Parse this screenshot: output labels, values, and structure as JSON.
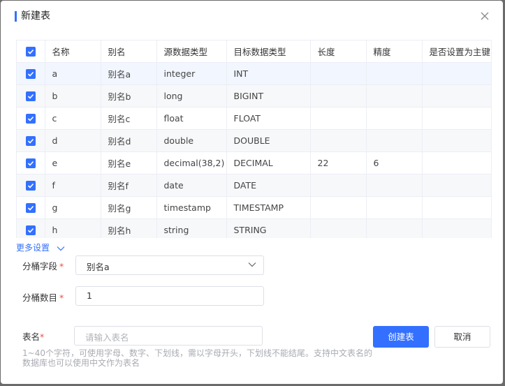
{
  "dialog": {
    "title": "新建表"
  },
  "table": {
    "columns": [
      "名称",
      "别名",
      "源数据类型",
      "目标数据类型",
      "长度",
      "精度",
      "是否设置为主键"
    ],
    "rows": [
      {
        "name": "a",
        "alias": "别名a",
        "src_type": "integer",
        "target_type": "INT",
        "length": "",
        "precision": ""
      },
      {
        "name": "b",
        "alias": "别名b",
        "src_type": "long",
        "target_type": "BIGINT",
        "length": "",
        "precision": ""
      },
      {
        "name": "c",
        "alias": "别名c",
        "src_type": "float",
        "target_type": "FLOAT",
        "length": "",
        "precision": ""
      },
      {
        "name": "d",
        "alias": "别名d",
        "src_type": "double",
        "target_type": "DOUBLE",
        "length": "",
        "precision": ""
      },
      {
        "name": "e",
        "alias": "别名e",
        "src_type": "decimal(38,2)",
        "target_type": "DECIMAL",
        "length": "22",
        "precision": "6"
      },
      {
        "name": "f",
        "alias": "别名f",
        "src_type": "date",
        "target_type": "DATE",
        "length": "",
        "precision": ""
      },
      {
        "name": "g",
        "alias": "别名g",
        "src_type": "timestamp",
        "target_type": "TIMESTAMP",
        "length": "",
        "precision": ""
      },
      {
        "name": "h",
        "alias": "别名h",
        "src_type": "string",
        "target_type": "STRING",
        "length": "",
        "precision": ""
      }
    ]
  },
  "more_settings": {
    "label": "更多设置"
  },
  "bucket_field": {
    "label": "分桶字段",
    "required_mark": "*",
    "value": "别名a"
  },
  "bucket_count": {
    "label": "分桶数目",
    "required_mark": "*",
    "value": "1"
  },
  "table_name": {
    "label": "表名",
    "required_mark": "*",
    "placeholder": "请输入表名",
    "hint": "1~40个字符，可使用字母、数字、下划线，需以字母开头，下划线不能结尾。支持中文表名的数据库也可以使用中文作为表名"
  },
  "buttons": {
    "create": "创建表",
    "cancel": "取消"
  },
  "colors": {
    "accent": "#3370ff",
    "required": "#f54a45"
  }
}
